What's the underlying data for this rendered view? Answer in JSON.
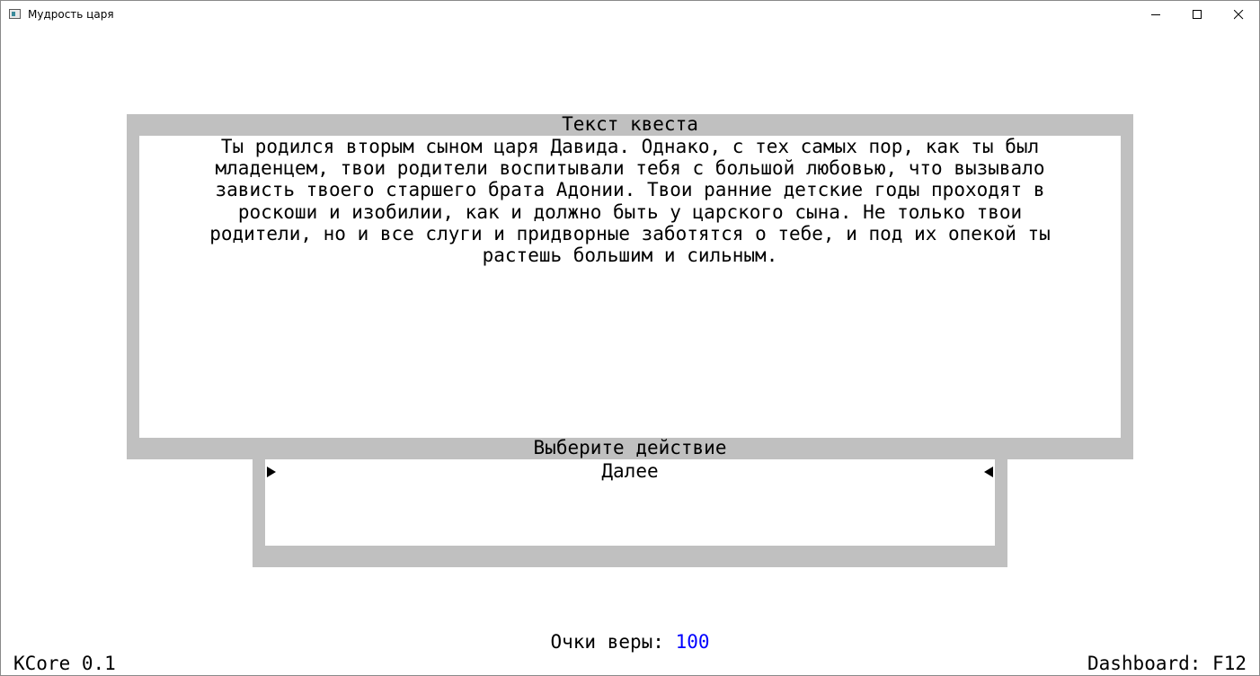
{
  "window": {
    "title": "Мудрость царя"
  },
  "quest": {
    "panel_title": "Текст квеста",
    "text": "Ты родился вторым сыном царя Давида. Однако, с тех самых пор, как ты был\nмладенцем, твои родители воспитывали тебя с большой любовью, что вызывало\nзависть твоего старшего брата Адонии. Твои ранние детские годы проходят в\nроскоши и изобилии, как и должно быть у царского сына. Не только твои\nродители, но и все слуги и придворные заботятся о тебе, и под их опекой ты\nрастешь большим и сильным."
  },
  "actions": {
    "panel_title": "Выберите действие",
    "items": [
      {
        "label": "Далее"
      }
    ]
  },
  "status": {
    "faith_label": "Очки веры: ",
    "faith_value": "100",
    "faith_value_color": "#0000ff",
    "version": "KCore 0.1",
    "dashboard": "Dashboard: F12"
  },
  "colors": {
    "panel": "#c0c0c0",
    "background": "#ffffff"
  },
  "icons": {
    "selector_left": "triangle-right-icon",
    "selector_right": "triangle-left-icon"
  }
}
